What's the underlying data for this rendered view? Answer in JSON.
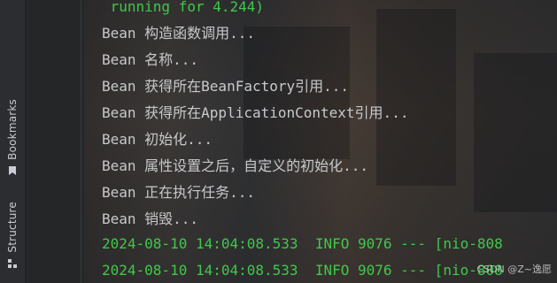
{
  "sidebar": {
    "bookmarks_label": "Bookmarks",
    "structure_label": "Structure"
  },
  "console": {
    "lines": [
      " running for 4.244)",
      "Bean 构造函数调用...",
      "Bean 名称...",
      "Bean 获得所在BeanFactory引用...",
      "Bean 获得所在ApplicationContext引用...",
      "Bean 初始化...",
      "Bean 属性设置之后，自定义的初始化...",
      "Bean 正在执行任务...",
      "Bean 销毁...",
      "2024-08-10 14:04:08.533  INFO 9076 --- [nio-808",
      "2024-08-10 14:04:08.533  INFO 9076 --- [nio-808"
    ]
  },
  "watermark": "CSDN @Z~逸愿",
  "colors": {
    "log_green": "#3ec94a",
    "text": "#c8c9cc"
  }
}
